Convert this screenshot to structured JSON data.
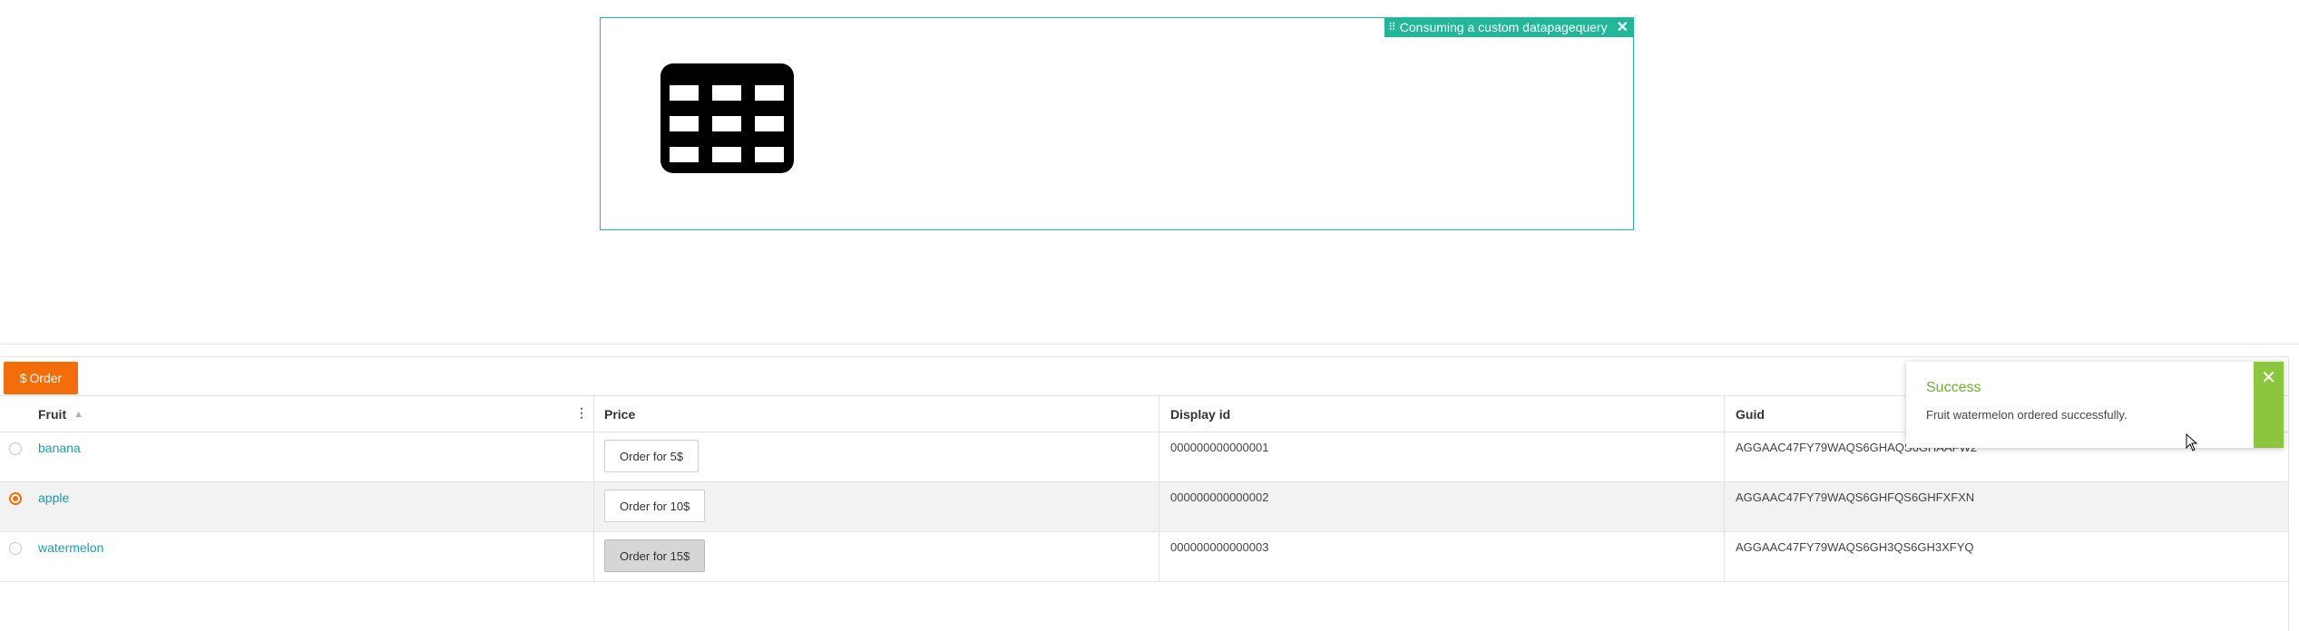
{
  "widget": {
    "tag_label": "Consuming a custom datapagequery",
    "tag_icon": "grip-icon",
    "close_icon": "close-icon",
    "placeholder_icon": "table-icon",
    "accent_color": "#21b89a"
  },
  "toolbar": {
    "order_label": "Order",
    "order_icon": "$",
    "order_color": "#f36d0a"
  },
  "grid": {
    "columns": [
      {
        "label": "Fruit",
        "sortable": true
      },
      {
        "label": "Price"
      },
      {
        "label": "Display id"
      },
      {
        "label": "Guid"
      }
    ],
    "rows": [
      {
        "fruit": "banana",
        "price_label": "Order for 5$",
        "display_id": "000000000000001",
        "guid": "AGGAAC47FY79WAQS6GHAQS6GHAAFW2",
        "selected": false
      },
      {
        "fruit": "apple",
        "price_label": "Order for 10$",
        "display_id": "000000000000002",
        "guid": "AGGAAC47FY79WAQS6GHFQS6GHFXFXN",
        "selected": true
      },
      {
        "fruit": "watermelon",
        "price_label": "Order for 15$",
        "display_id": "000000000000003",
        "guid": "AGGAAC47FY79WAQS6GH3QS6GH3XFYQ",
        "selected": false
      }
    ]
  },
  "toast": {
    "title": "Success",
    "message": "Fruit watermelon ordered successfully.",
    "close_icon": "close-icon",
    "color": "#8cc63f"
  }
}
